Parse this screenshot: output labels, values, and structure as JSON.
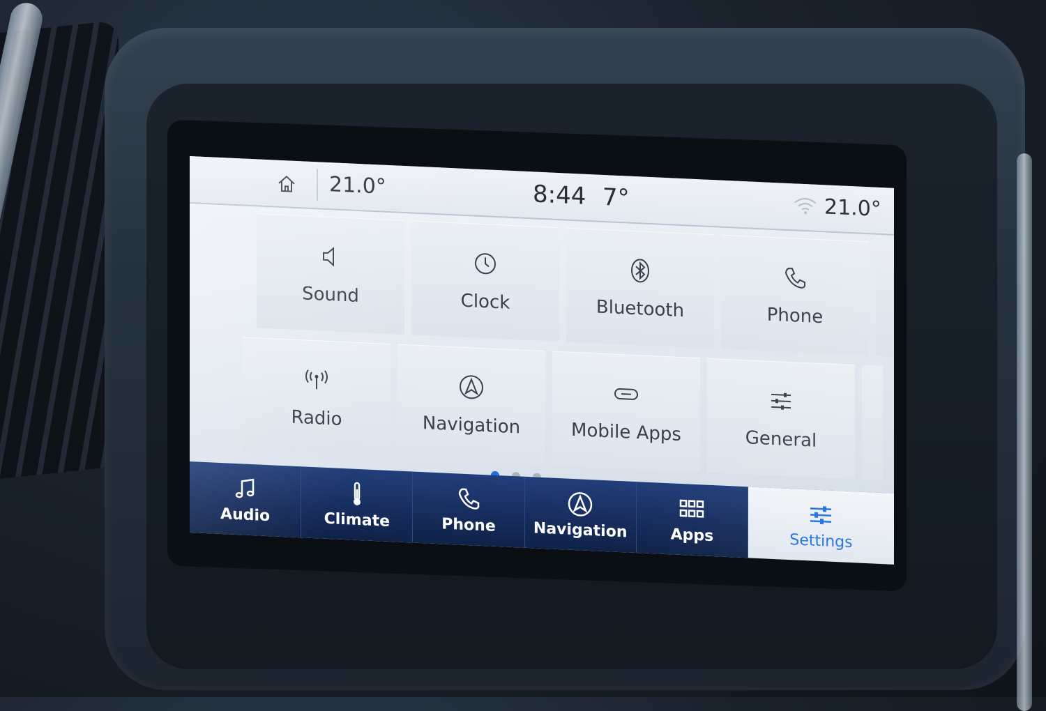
{
  "status_bar": {
    "driver_temp": "21.0°",
    "time": "8:44",
    "outside_temp": "7°",
    "passenger_temp": "21.0°",
    "home_icon": "home-icon",
    "wifi_icon": "wifi-icon"
  },
  "settings_grid": {
    "tiles": [
      {
        "label": "Sound",
        "icon": "speaker-icon"
      },
      {
        "label": "Clock",
        "icon": "clock-icon"
      },
      {
        "label": "Bluetooth",
        "icon": "bluetooth-icon"
      },
      {
        "label": "Phone",
        "icon": "phone-icon"
      },
      {
        "label": "Radio",
        "icon": "antenna-icon"
      },
      {
        "label": "Navigation",
        "icon": "navigation-arrow-icon"
      },
      {
        "label": "Mobile Apps",
        "icon": "link-icon"
      },
      {
        "label": "General",
        "icon": "sliders-icon"
      }
    ],
    "pages": 3,
    "current_page": 1
  },
  "bottom_nav": {
    "items": [
      {
        "label": "Audio",
        "icon": "music-note-icon"
      },
      {
        "label": "Climate",
        "icon": "thermometer-icon"
      },
      {
        "label": "Phone",
        "icon": "phone-icon"
      },
      {
        "label": "Navigation",
        "icon": "navigation-arrow-icon"
      },
      {
        "label": "Apps",
        "icon": "apps-grid-icon"
      },
      {
        "label": "Settings",
        "icon": "sliders-icon"
      }
    ],
    "active": "Settings"
  },
  "colors": {
    "accent": "#1f6fe0",
    "nav_bar": "#172c5c",
    "screen_bg": "#e3e9f0",
    "text": "#3a414a"
  }
}
